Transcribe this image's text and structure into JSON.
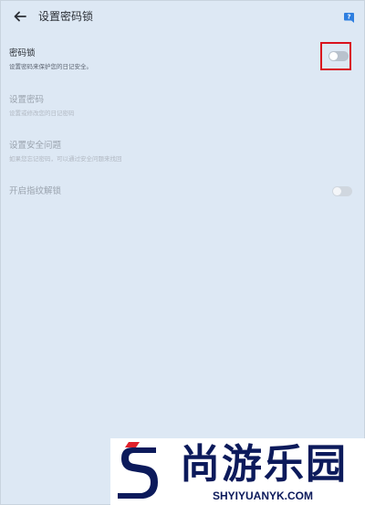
{
  "header": {
    "title": "设置密码锁",
    "back_icon": "arrow-left-icon",
    "help_icon": "help-icon"
  },
  "settings": [
    {
      "title": "密码锁",
      "desc": "设置密码来保护您的日记安全。",
      "toggle": "off",
      "enabled": true
    },
    {
      "title": "设置密码",
      "desc": "设置或修改您的日记密码",
      "enabled": false
    },
    {
      "title": "设置安全问题",
      "desc": "如果您忘记密码，可以通过安全问题来找回",
      "enabled": false
    },
    {
      "title": "开启指纹解锁",
      "toggle": "off",
      "enabled": false
    }
  ],
  "watermark": {
    "text": "尚游乐园",
    "domain": "SHYIYUANYK.COM"
  },
  "colors": {
    "background": "#dde8f4",
    "highlight": "#d9121e",
    "help_icon": "#2f7fe0",
    "watermark_navy": "#0c1a5b",
    "watermark_red": "#e0202b"
  }
}
